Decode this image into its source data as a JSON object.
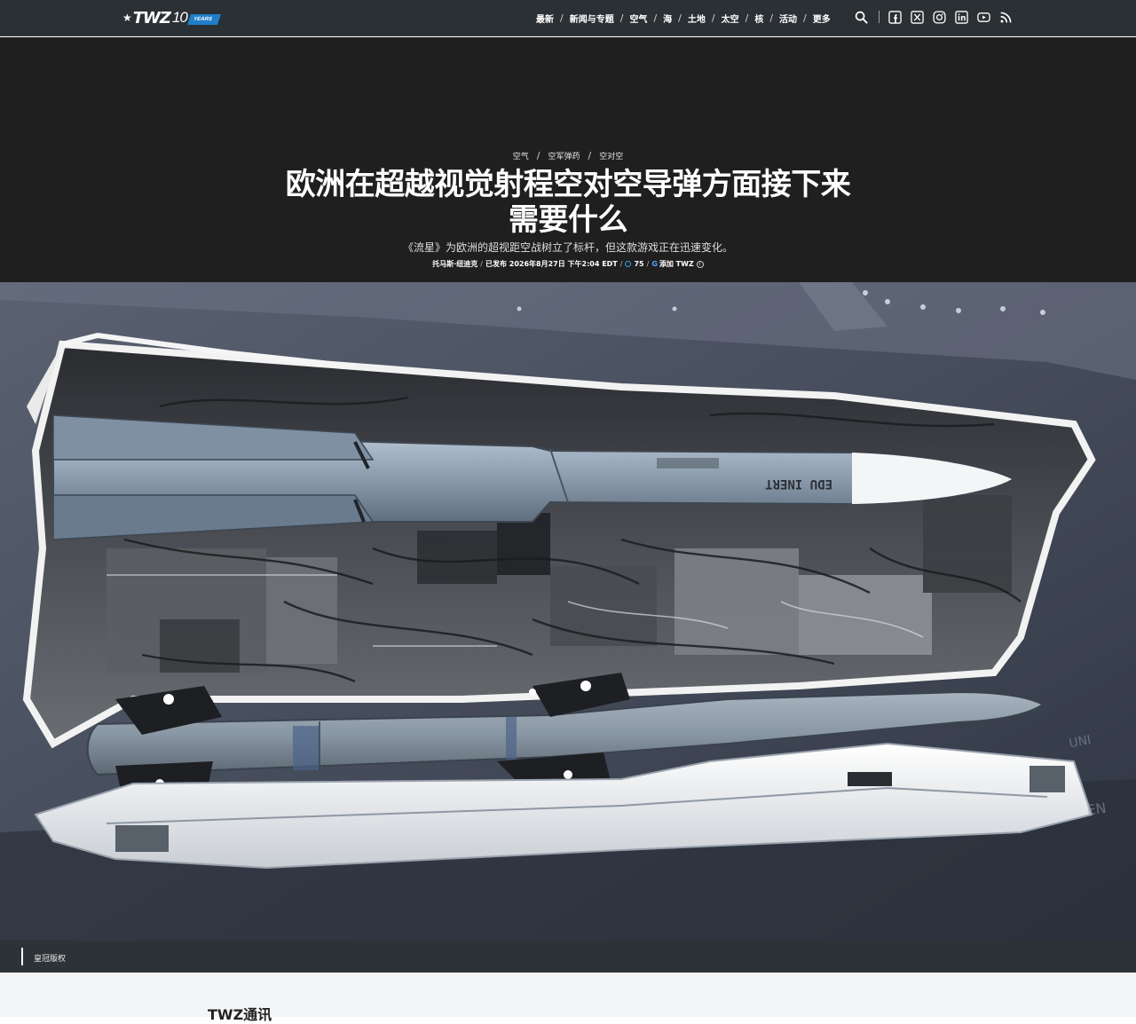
{
  "logo": {
    "brand": "TWZ",
    "anniversary": "10",
    "years": "YEARS"
  },
  "nav": {
    "items": [
      "最新",
      "新闻与专题",
      "空气",
      "海",
      "土地",
      "太空",
      "核",
      "活动",
      "更多"
    ],
    "separator": "/"
  },
  "icons": [
    "search-icon",
    "facebook-icon",
    "x-icon",
    "instagram-icon",
    "linkedin-icon",
    "youtube-icon",
    "rss-icon"
  ],
  "article": {
    "breadcrumbs": [
      "空气",
      "空军弹药",
      "空对空"
    ],
    "breadcrumb_sep": "/",
    "title": "欧洲在超越视觉射程空对空导弹方面接下来需要什么",
    "subtitle": "《流星》为欧洲的超视距空战树立了标杆，但这款游戏正在迅速变化。",
    "author": "托马斯·纽迪克",
    "published": "已发布 2026年8月27日 下午2:04 EDT",
    "comments": "75",
    "add_source": "添加 TWZ",
    "sep": "/"
  },
  "image": {
    "missile_marking": "EDU INERT",
    "caption": "皇冠版权"
  },
  "newsletter": {
    "title": "TWZ通讯"
  },
  "colors": {
    "nav_bg": "#2b3034",
    "hero_bg": "#1f1f1f",
    "accent": "#1f7fc8"
  }
}
